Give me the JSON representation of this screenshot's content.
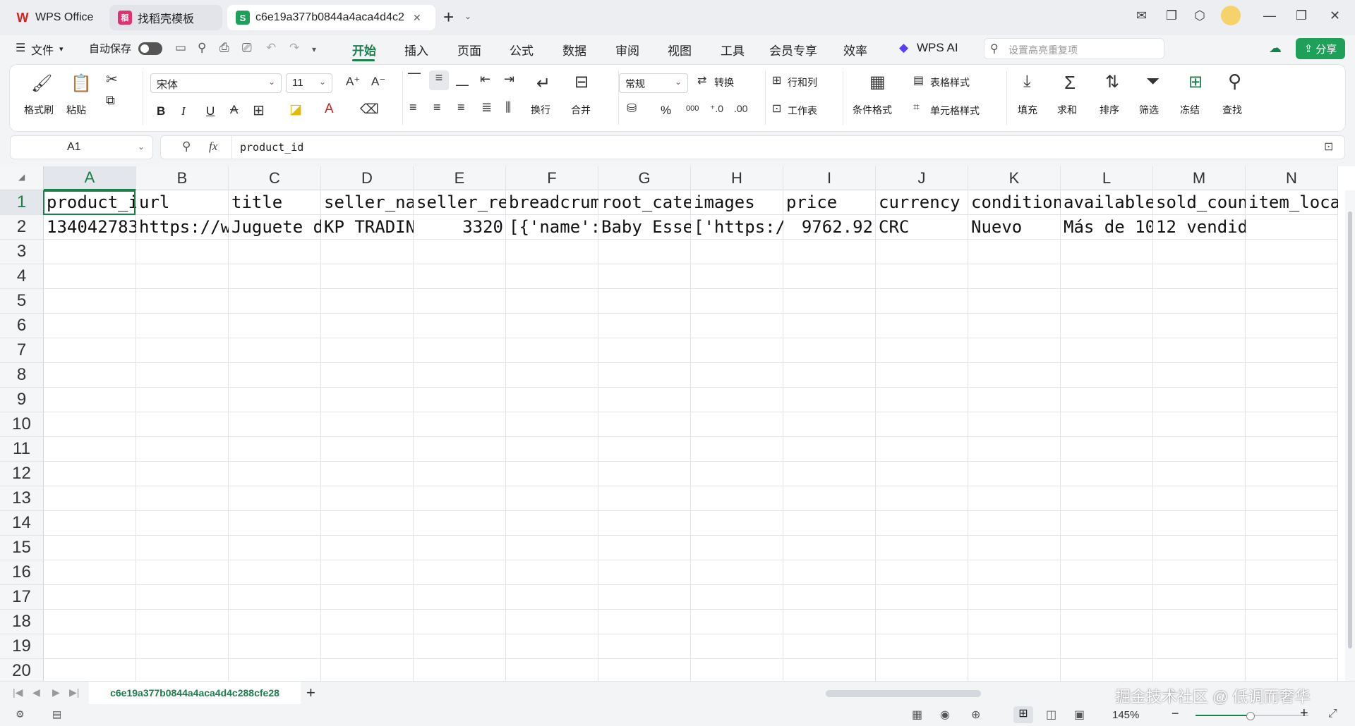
{
  "titlebar": {
    "tabs": [
      {
        "label": "WPS Office",
        "logo": "W",
        "color": "#d3231e"
      },
      {
        "label": "找稻壳模板",
        "logo": "稻",
        "color": "#e0336e"
      },
      {
        "label": "c6e19a377b0844a4aca4d4c2",
        "logo": "S",
        "color": "#1ea05a"
      }
    ],
    "new_tab": "+",
    "close": "✕"
  },
  "menubar": {
    "file": "文件",
    "autosave": "自动保存",
    "tabs": [
      "开始",
      "插入",
      "页面",
      "公式",
      "数据",
      "审阅",
      "视图",
      "工具",
      "会员专享",
      "效率"
    ],
    "active_tab": "开始",
    "wps_ai": "WPS AI",
    "search_placeholder": "设置高亮重复项",
    "share": "分享"
  },
  "ribbon": {
    "format_painter": "格式刷",
    "paste": "粘贴",
    "font_name": "宋体",
    "font_size": "11",
    "wrap": "换行",
    "merge": "合并",
    "number_format": "常规",
    "convert": "转换",
    "rows_cols": "行和列",
    "worksheet": "工作表",
    "conditional": "条件格式",
    "table_style": "表格样式",
    "cell_style": "单元格样式",
    "fill": "填充",
    "sum": "求和",
    "sort": "排序",
    "filter": "筛选",
    "freeze": "冻结",
    "find": "查找",
    "bold": "B",
    "italic": "I",
    "underline": "U",
    "percent": "%",
    "thousands": "000"
  },
  "formula": {
    "name_box": "A1",
    "fx": "fx",
    "value": "product_id"
  },
  "sheet": {
    "columns": [
      "A",
      "B",
      "C",
      "D",
      "E",
      "F",
      "G",
      "H",
      "I",
      "J",
      "K",
      "L",
      "M",
      "N"
    ],
    "rows": [
      "1",
      "2",
      "3",
      "4",
      "5",
      "6",
      "7",
      "8",
      "9",
      "10",
      "11",
      "12",
      "13",
      "14",
      "15",
      "16",
      "17",
      "18",
      "19",
      "20"
    ],
    "row1": [
      "product_i",
      "url",
      "title",
      "seller_na",
      "seller_re",
      "breadcrum",
      "root_cate",
      "images",
      "price",
      "currency",
      "condition",
      "available",
      "sold_coun",
      "item_loca"
    ],
    "row2": [
      "134042783",
      "https://w",
      "Juguete d",
      "KP TRADIN",
      "3320",
      "[{'name':",
      "Baby Esse",
      "['https:/",
      "9762.92",
      "CRC",
      "Nuevo",
      "Más de 10",
      "12 vendido",
      ""
    ]
  },
  "sheetbar": {
    "sheet_name": "c6e19a377b0844a4aca4d4c288cfe28",
    "add": "+"
  },
  "statusbar": {
    "zoom": "145%",
    "watermark": "掘金技术社区 @ 低调而奢华"
  },
  "colors": {
    "accent": "#1a7f4b",
    "share_bg": "#1ea05a"
  }
}
